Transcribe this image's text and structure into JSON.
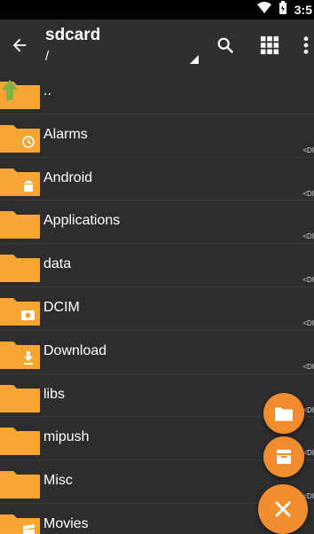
{
  "status_bar": {
    "time": "3:5",
    "icons": [
      "wifi-icon",
      "battery-icon"
    ]
  },
  "app_bar": {
    "title": "sdcard",
    "path": "/",
    "actions": [
      "search-icon",
      "grid-view-icon",
      "more-vert-icon"
    ]
  },
  "rows": [
    {
      "label": "..",
      "type": "",
      "icon": "parent-folder-icon"
    },
    {
      "label": "Alarms",
      "type": "<DI",
      "icon": "alarm-folder-icon"
    },
    {
      "label": "Android",
      "type": "<DI",
      "icon": "android-folder-icon"
    },
    {
      "label": "Applications",
      "type": "<DI",
      "icon": "folder-icon"
    },
    {
      "label": "data",
      "type": "<DI",
      "icon": "folder-icon"
    },
    {
      "label": "DCIM",
      "type": "<DI",
      "icon": "camera-folder-icon"
    },
    {
      "label": "Download",
      "type": "<DI",
      "icon": "download-folder-icon"
    },
    {
      "label": "libs",
      "type": "<DI",
      "icon": "folder-icon"
    },
    {
      "label": "mipush",
      "type": "<DI",
      "icon": "folder-icon"
    },
    {
      "label": "Misc",
      "type": "<DI",
      "icon": "folder-icon"
    },
    {
      "label": "Movies",
      "type": "",
      "icon": "movie-folder-icon"
    }
  ],
  "fabs": [
    "new-folder-icon",
    "new-archive-icon",
    "close-icon"
  ],
  "colors": {
    "accent": "#f28d2f",
    "folder": "#f7a534",
    "background": "#2d2d2d",
    "appbar": "#2f2f2f"
  }
}
